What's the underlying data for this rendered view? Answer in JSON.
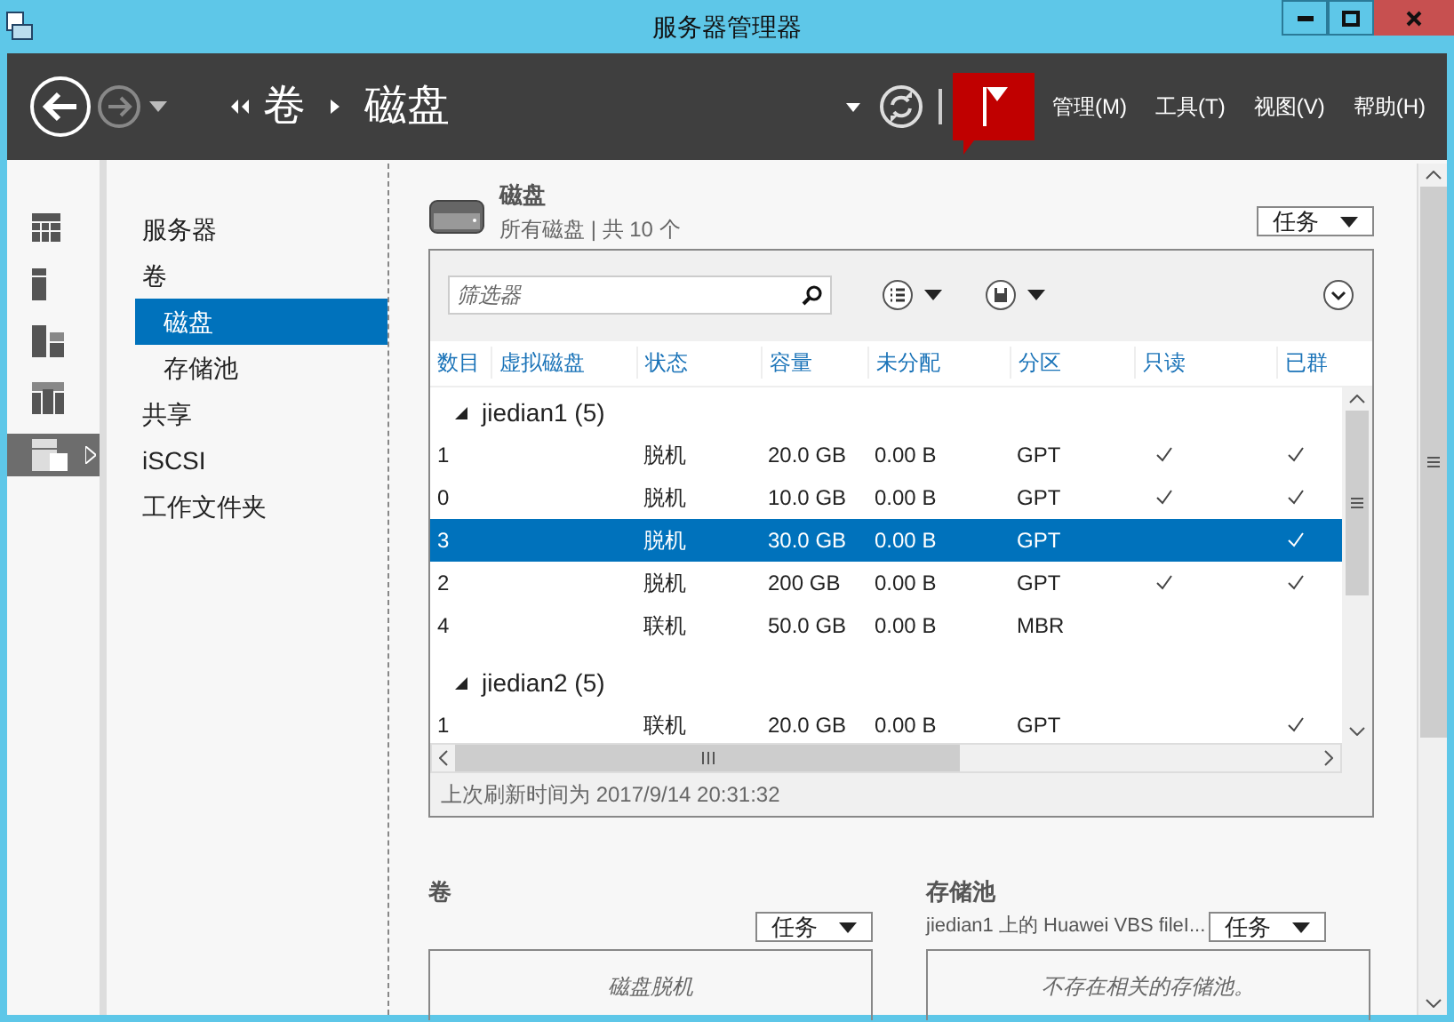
{
  "window": {
    "title": "服务器管理器"
  },
  "header": {
    "breadcrumb": [
      "卷",
      "磁盘"
    ],
    "menu": [
      "管理(M)",
      "工具(T)",
      "视图(V)",
      "帮助(H)"
    ]
  },
  "rail": [
    {
      "selected": false
    },
    {
      "selected": false
    },
    {
      "selected": false
    },
    {
      "selected": false
    },
    {
      "selected": true
    }
  ],
  "nav": [
    {
      "label": "服务器",
      "selected": false
    },
    {
      "label": "卷",
      "selected": false,
      "children": [
        {
          "label": "磁盘",
          "selected": true
        },
        {
          "label": "存储池",
          "selected": false
        }
      ]
    },
    {
      "label": "共享",
      "selected": false
    },
    {
      "label": "iSCSI",
      "selected": false
    },
    {
      "label": "工作文件夹",
      "selected": false
    }
  ],
  "disks": {
    "title": "磁盘",
    "subtitle": "所有磁盘 | 共 10 个",
    "tasks": "任务",
    "filter_placeholder": "筛选器",
    "columns": [
      "数目",
      "虚拟磁盘",
      "状态",
      "容量",
      "未分配",
      "分区",
      "只读",
      "已群"
    ],
    "groups": [
      {
        "label": "jiedian1 (5)",
        "expanded": true,
        "rows": [
          {
            "number": "1",
            "status": "脱机",
            "capacity": "20.0 GB",
            "unallocated": "0.00 B",
            "partition": "GPT",
            "read_only": true,
            "clustered": true,
            "selected": false
          },
          {
            "number": "0",
            "status": "脱机",
            "capacity": "10.0 GB",
            "unallocated": "0.00 B",
            "partition": "GPT",
            "read_only": true,
            "clustered": true,
            "selected": false
          },
          {
            "number": "3",
            "status": "脱机",
            "capacity": "30.0 GB",
            "unallocated": "0.00 B",
            "partition": "GPT",
            "read_only": false,
            "clustered": true,
            "selected": true
          },
          {
            "number": "2",
            "status": "脱机",
            "capacity": "200 GB",
            "unallocated": "0.00 B",
            "partition": "GPT",
            "read_only": true,
            "clustered": true,
            "selected": false
          },
          {
            "number": "4",
            "status": "联机",
            "capacity": "50.0 GB",
            "unallocated": "0.00 B",
            "partition": "MBR",
            "read_only": false,
            "clustered": false,
            "selected": false
          }
        ]
      },
      {
        "label": "jiedian2 (5)",
        "expanded": true,
        "rows": [
          {
            "number": "1",
            "status": "联机",
            "capacity": "20.0 GB",
            "unallocated": "0.00 B",
            "partition": "GPT",
            "read_only": false,
            "clustered": true,
            "selected": false
          }
        ]
      }
    ],
    "status": "上次刷新时间为 2017/9/14 20:31:32"
  },
  "volumes": {
    "title": "卷",
    "tasks": "任务",
    "message": "磁盘脱机"
  },
  "pools": {
    "title": "存储池",
    "subtitle": "jiedian1 上的 Huawei VBS fileI...",
    "tasks": "任务",
    "message": "不存在相关的存储池。"
  }
}
